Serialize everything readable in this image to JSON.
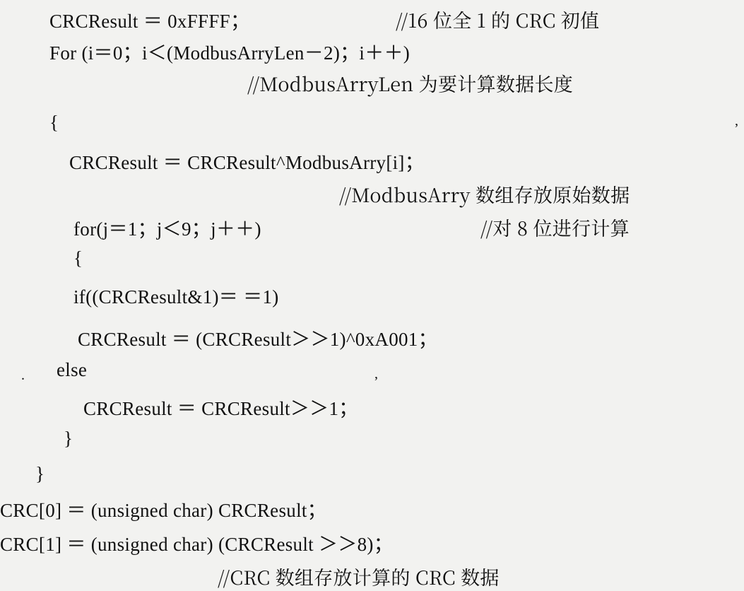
{
  "lines": {
    "l1_code": "CRCResult ＝ 0xFFFF；",
    "l1_cmt": "//16 位全 1 的 CRC 初值",
    "l2": "For (i＝0；i＜(ModbusArryLen－2)；i＋＋)",
    "l3_cmt": "//ModbusArryLen 为要计算数据长度",
    "l4": "{",
    "l5": "CRCResult ＝ CRCResult^ModbusArry[i]；",
    "l6_cmt": "//ModbusArry 数组存放原始数据",
    "l7_code": "for(j＝1；j＜9；j＋＋)",
    "l7_cmt": "//对 8 位进行计算",
    "l8": "{",
    "l9": "if((CRCResult&1)＝ ＝1)",
    "l10": "CRCResult ＝ (CRCResult＞＞1)^0xA001；",
    "l11": "else",
    "l12": "CRCResult ＝ CRCResult＞＞1；",
    "l13": "}",
    "l14": "}",
    "l15": "CRC[0] ＝ (unsigned char) CRCResult；",
    "l16": "CRC[1] ＝ (unsigned char) (CRCResult ＞＞8)；",
    "l17_cmt": "//CRC 数组存放计算的 CRC 数据"
  }
}
